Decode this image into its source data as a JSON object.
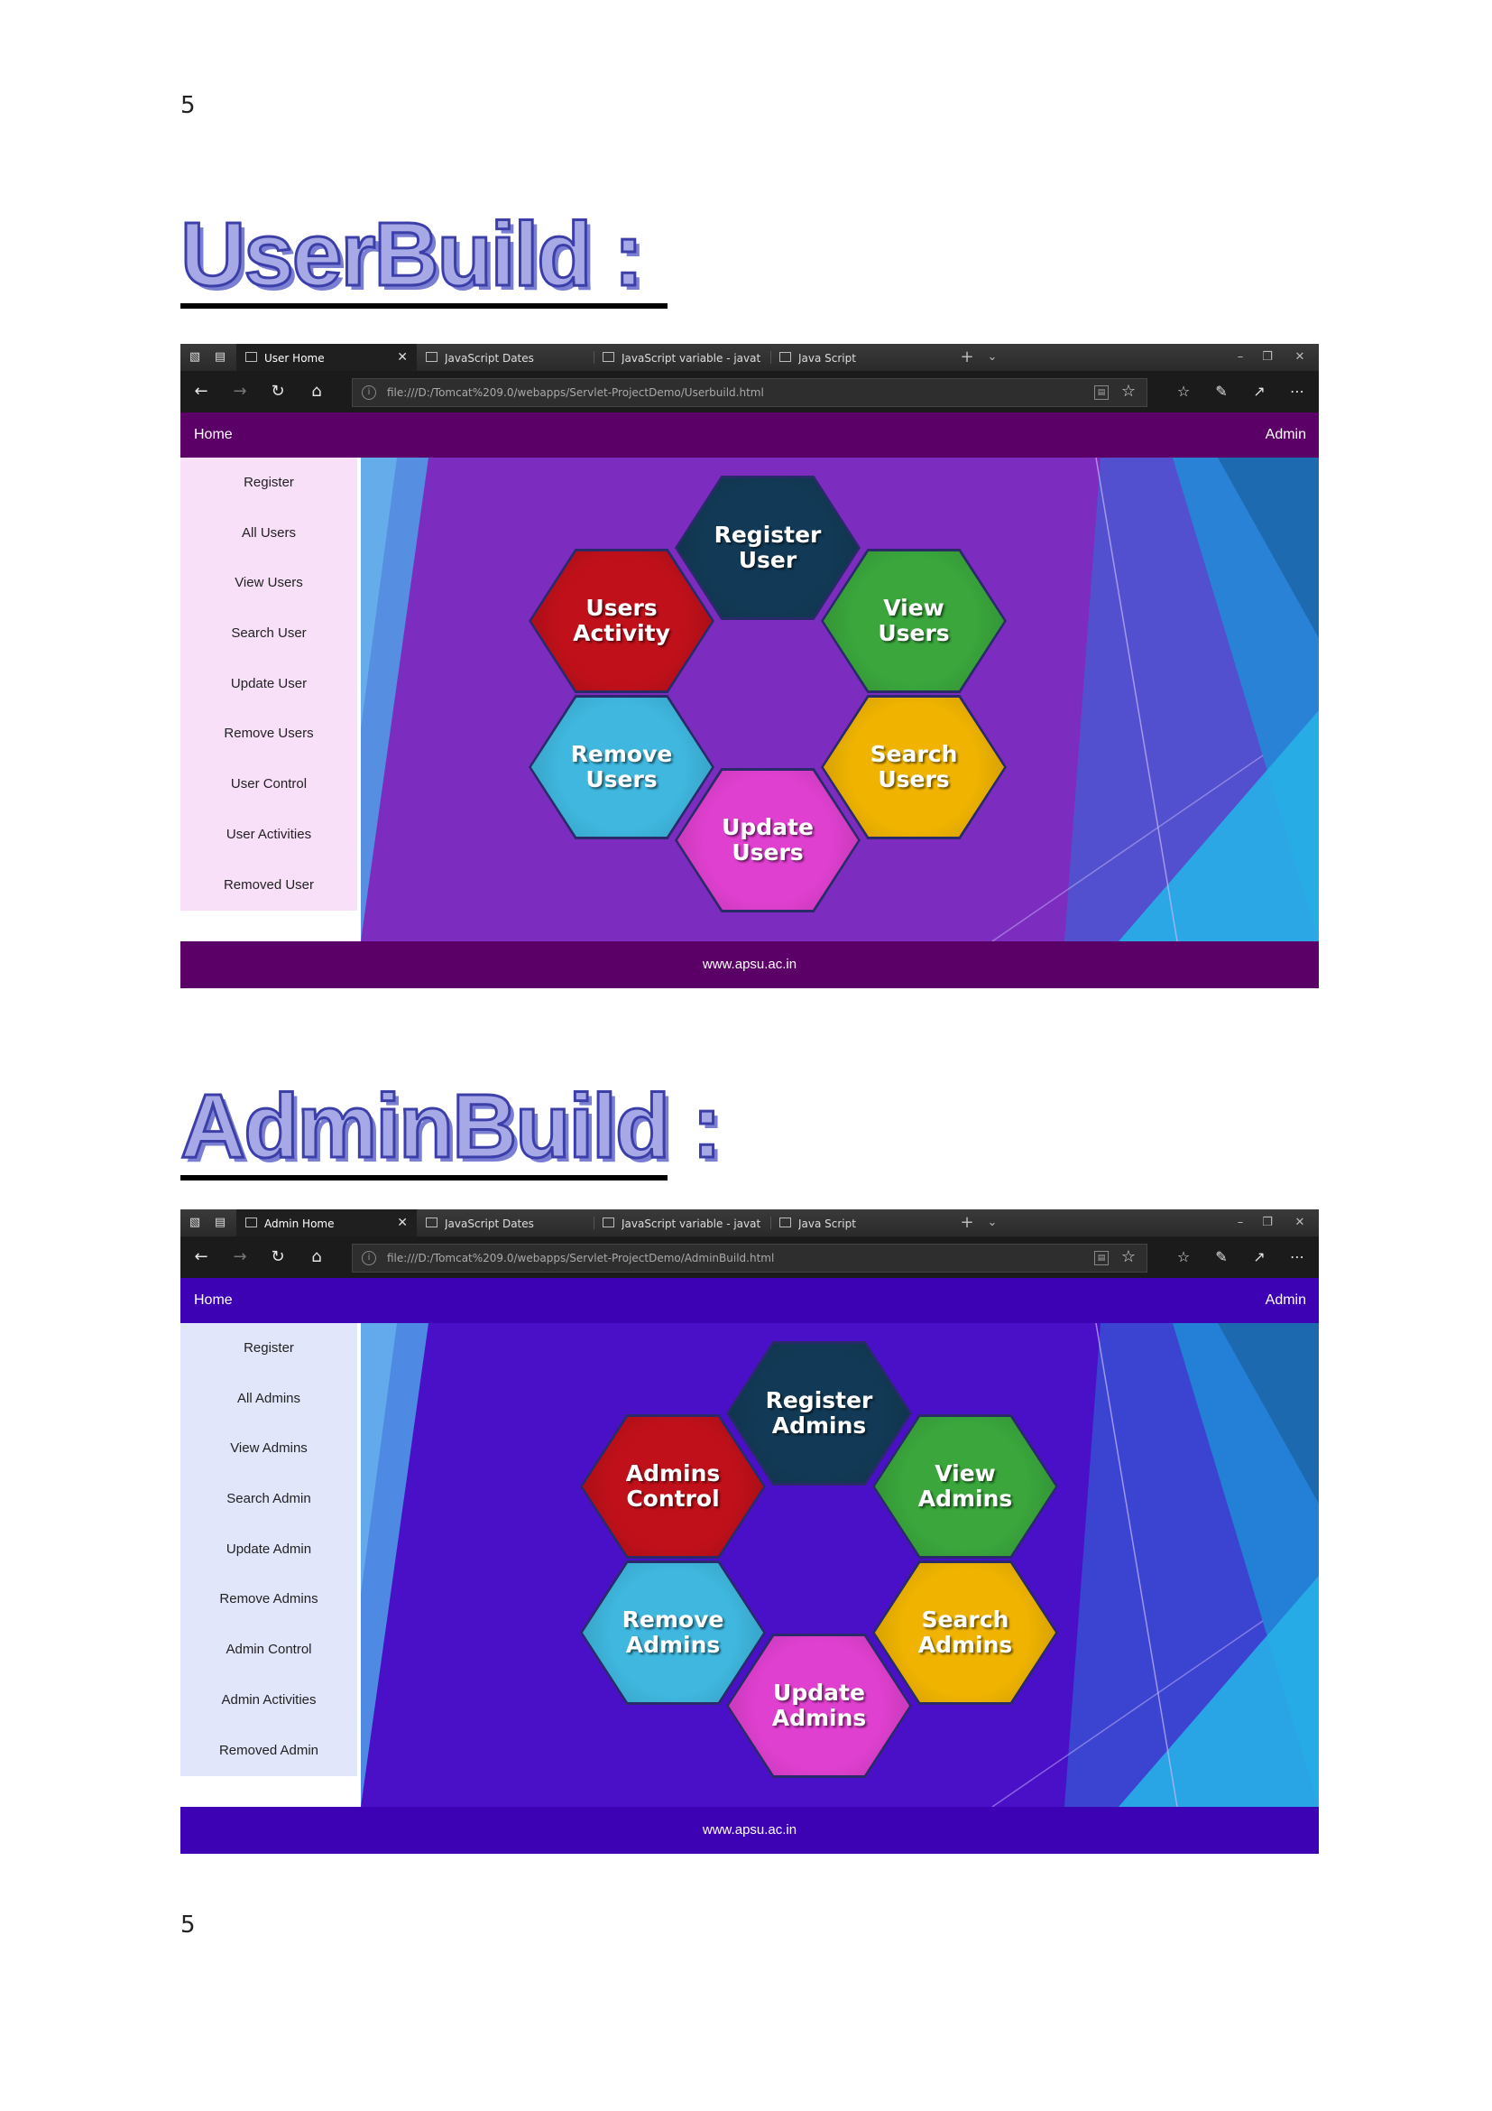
{
  "page": {
    "number_top": "5",
    "number_bottom": "5"
  },
  "sections": [
    {
      "heading": "UserBuild :",
      "browser": {
        "tabs": [
          "User Home",
          "JavaScript Dates",
          "JavaScript variable - javatpc",
          "Java Script"
        ],
        "url": "file:///D:/Tomcat%209.0/webapps/Servlet-ProjectDemo/Userbuild.html"
      },
      "site": {
        "nav_home": "Home",
        "nav_admin": "Admin",
        "sidebar": [
          "Register",
          "All Users",
          "View Users",
          "Search User",
          "Update User",
          "Remove Users",
          "User Control",
          "User Activities",
          "Removed User"
        ],
        "hexagons": [
          {
            "label": "Register\nUser",
            "color": "#123a56"
          },
          {
            "label": "Users\nActivity",
            "color": "#c0101a"
          },
          {
            "label": "View\nUsers",
            "color": "#3aa63c"
          },
          {
            "label": "Remove\nUsers",
            "color": "#3fb7df"
          },
          {
            "label": "Search\nUsers",
            "color": "#f0b400"
          },
          {
            "label": "Update\nUsers",
            "color": "#e040d0"
          }
        ],
        "footer": "www.apsu.ac.in",
        "colors": {
          "nav": "#5a0066",
          "sidebar": "#f8e0f8",
          "hero": "#7d2cc0"
        }
      }
    },
    {
      "heading": "AdminBuild :",
      "browser": {
        "tabs": [
          "Admin Home",
          "JavaScript Dates",
          "JavaScript variable - javatpc",
          "Java Script"
        ],
        "url": "file:///D:/Tomcat%209.0/webapps/Servlet-ProjectDemo/AdminBuild.html"
      },
      "site": {
        "nav_home": "Home",
        "nav_admin": "Admin",
        "sidebar": [
          "Register",
          "All Admins",
          "View Admins",
          "Search Admin",
          "Update Admin",
          "Remove Admins",
          "Admin Control",
          "Admin Activities",
          "Removed Admin"
        ],
        "hexagons": [
          {
            "label": "Register\nAdmins",
            "color": "#123a56"
          },
          {
            "label": "Admins\nControl",
            "color": "#c0101a"
          },
          {
            "label": "View\nAdmins",
            "color": "#3aa63c"
          },
          {
            "label": "Remove\nAdmins",
            "color": "#3fb7df"
          },
          {
            "label": "Search\nAdmins",
            "color": "#f0b400"
          },
          {
            "label": "Update\nAdmins",
            "color": "#e040d0"
          }
        ],
        "footer": "www.apsu.ac.in",
        "colors": {
          "nav": "#3c02b4",
          "sidebar": "#e2e6fa",
          "hero": "#4a10c8"
        }
      }
    }
  ]
}
